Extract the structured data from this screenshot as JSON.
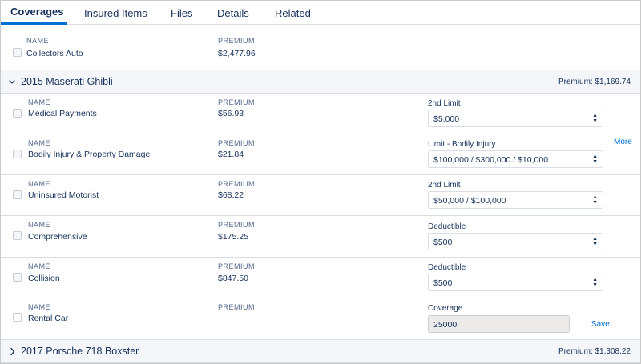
{
  "tabs": [
    {
      "label": "Coverages"
    },
    {
      "label": "Insured Items"
    },
    {
      "label": "Files"
    },
    {
      "label": "Details"
    },
    {
      "label": "Related"
    }
  ],
  "col_labels": {
    "name": "NAME",
    "premium": "PREMIUM"
  },
  "top_item": {
    "name": "Collectors Auto",
    "premium": "$2,477.96"
  },
  "groups": [
    {
      "title": "2015 Maserati Ghibli",
      "premium": "Premium: $1,169.74",
      "expanded": true
    },
    {
      "title": "2017 Porsche 718 Boxster",
      "premium": "Premium: $1,308.22",
      "expanded": false
    }
  ],
  "coverages": [
    {
      "name": "Medical Payments",
      "premium": "$56.93",
      "field_label": "2nd Limit",
      "field_value": "$5,000"
    },
    {
      "name": "Bodily Injury & Property Damage",
      "premium": "$21.84",
      "field_label": "Limit - Bodily Injury",
      "field_value": "$100,000 / $300,000 / $10,000",
      "link": "More"
    },
    {
      "name": "Uninsured Motorist",
      "premium": "$68.22",
      "field_label": "2nd Limit",
      "field_value": "$50,000 / $100,000"
    },
    {
      "name": "Comprehensive",
      "premium": "$175.25",
      "field_label": "Deductible",
      "field_value": "$500"
    },
    {
      "name": "Collision",
      "premium": "$847.50",
      "field_label": "Deductible",
      "field_value": "$500"
    },
    {
      "name": "Rental Car",
      "premium": "",
      "field_label": "Coverage",
      "field_value": "25000",
      "link": "Save"
    }
  ],
  "icons": {
    "chevron_down": "⌄",
    "chevron_right": "›",
    "select_arrows": "▲▼"
  }
}
